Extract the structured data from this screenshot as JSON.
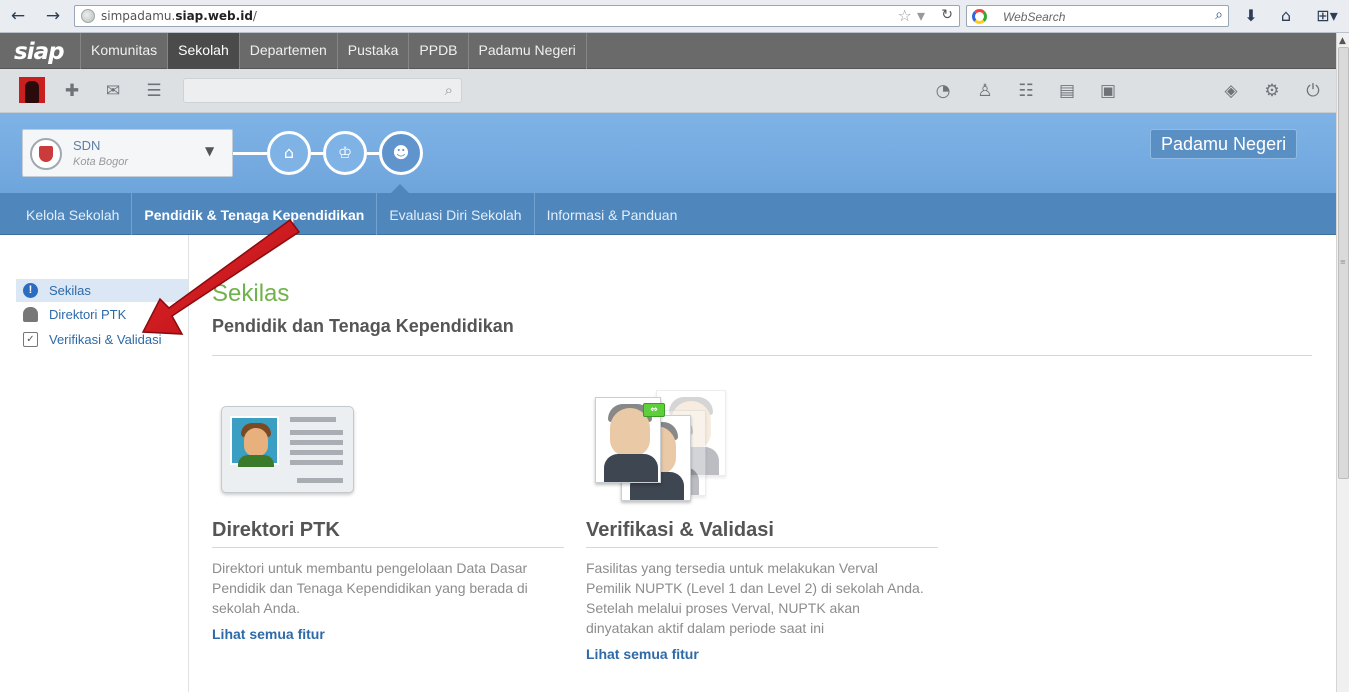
{
  "browser": {
    "url_prefix": "simpadamu.",
    "url_domain": "siap.web.id",
    "url_suffix": "/",
    "search_placeholder": "WebSearch",
    "icons": [
      "back-arrow-icon",
      "forward-arrow-icon",
      "bookmark-star-icon",
      "reload-icon",
      "search-engine-icon",
      "magnifier-icon",
      "download-icon",
      "home-icon",
      "addons-icon"
    ]
  },
  "site_nav": {
    "logo": "siap",
    "tabs": [
      {
        "label": "Komunitas"
      },
      {
        "label": "Sekolah",
        "active": true
      },
      {
        "label": "Departemen"
      },
      {
        "label": "Pustaka"
      },
      {
        "label": "PPDB"
      },
      {
        "label": "Padamu Negeri"
      }
    ]
  },
  "util_bar": {
    "search_placeholder": ""
  },
  "header": {
    "school_name": "SDN",
    "school_city": "Kota Bogor",
    "badge": "Padamu Negeri"
  },
  "section_nav": {
    "tabs": [
      {
        "label": "Kelola Sekolah"
      },
      {
        "label": "Pendidik & Tenaga Kependidikan",
        "active": true
      },
      {
        "label": "Evaluasi Diri Sekolah"
      },
      {
        "label": "Informasi & Panduan"
      }
    ]
  },
  "sidebar": {
    "items": [
      {
        "label": "Sekilas",
        "active": true
      },
      {
        "label": "Direktori PTK"
      },
      {
        "label": "Verifikasi & Validasi"
      }
    ]
  },
  "main": {
    "title": "Sekilas",
    "subtitle": "Pendidik dan Tenaga Kependidikan",
    "cards": [
      {
        "title": "Direktori PTK",
        "description": "Direktori untuk membantu pengelolaan Data Dasar Pendidik dan Tenaga Kependidikan yang berada di sekolah Anda.",
        "link": "Lihat semua fitur"
      },
      {
        "title": "Verifikasi & Validasi",
        "description": "Fasilitas yang tersedia untuk melakukan Verval Pemilik NUPTK (Level 1 dan Level 2) di sekolah Anda. Setelah melalui proses Verval, NUPTK akan dinyatakan aktif dalam periode saat ini",
        "link": "Lihat semua fitur"
      }
    ]
  },
  "colors": {
    "accent_green": "#6fb34a",
    "header_blue": "#7fb3e6",
    "section_blue": "#4f87bd",
    "link_blue": "#2e6aa8",
    "annotation_red": "#d0161b"
  }
}
